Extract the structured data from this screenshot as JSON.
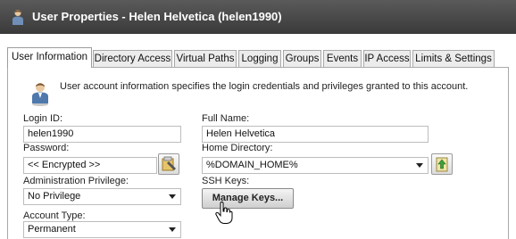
{
  "title_bar": {
    "title": "User Properties - Helen Helvetica (helen1990)"
  },
  "tabs": [
    {
      "label": "User Information",
      "active": true
    },
    {
      "label": "Directory Access"
    },
    {
      "label": "Virtual Paths"
    },
    {
      "label": "Logging"
    },
    {
      "label": "Groups"
    },
    {
      "label": "Events"
    },
    {
      "label": "IP Access"
    },
    {
      "label": "Limits & Settings"
    }
  ],
  "intro_text": "User account information specifies the login credentials and privileges granted to this account.",
  "form": {
    "login_id": {
      "label": "Login ID:",
      "value": "helen1990"
    },
    "password": {
      "label": "Password:",
      "value": "<< Encrypted >>"
    },
    "admin_privilege": {
      "label": "Administration Privilege:",
      "value": "No Privilege"
    },
    "account_type": {
      "label": "Account Type:",
      "value": "Permanent"
    },
    "full_name": {
      "label": "Full Name:",
      "value": "Helen Helvetica"
    },
    "home_directory": {
      "label": "Home Directory:",
      "value": "%DOMAIN_HOME%"
    },
    "ssh_keys": {
      "label": "SSH Keys:",
      "button_label": "Manage Keys..."
    }
  },
  "icons": {
    "title": "user-icon",
    "header": "user-icon",
    "password_button": "key-edit-icon",
    "home_dir_button": "folder-up-icon",
    "pointer": "hand-pointer-icon"
  }
}
